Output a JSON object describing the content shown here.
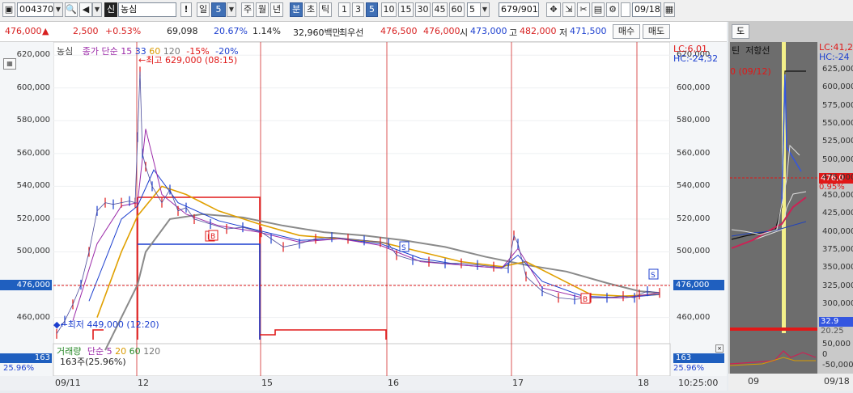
{
  "toolbar": {
    "code": "004370",
    "tag": "신",
    "name": "농심",
    "alert": "!",
    "period_label": "일",
    "period_value": "5",
    "tabs": [
      "주",
      "월",
      "년",
      "분",
      "초",
      "틱"
    ],
    "minutes": [
      "1",
      "3",
      "5",
      "10",
      "15",
      "30",
      "45",
      "60"
    ],
    "count": "5",
    "pages": "679/901",
    "date": "09/18"
  },
  "quote": {
    "price": "476,000",
    "change": "2,500",
    "pct": "+0.53%",
    "volume": "69,098",
    "turnover": "20.67%",
    "ratio": "1.14%",
    "amount": "32,960백만",
    "best_label": "최우선",
    "best_ask": "476,500",
    "best_bid": "476,000",
    "open_label": "시",
    "open": "473,000",
    "high_label": "고",
    "high": "482,000",
    "low_label": "저",
    "low": "471,500",
    "buy": "매수",
    "sell": "매도"
  },
  "legend": {
    "name": "농심",
    "ma_label": "종가 단순",
    "ma_periods": [
      "15",
      "33",
      "60",
      "120"
    ],
    "env1": "-15%",
    "env2": "-20%"
  },
  "annotations": {
    "high": "최고 629,000 (08:15)",
    "low": "최저 449,000 (12:20)",
    "lc": "LC:6,01",
    "hc": "HC:-24,32",
    "current_tag": "476,000"
  },
  "volume_legend": {
    "label": "거래량",
    "ma_label": "단순",
    "periods": [
      "5",
      "20",
      "60",
      "120"
    ],
    "value": "163주(25.96%)",
    "tag_value": "163",
    "tag_pct": "25.96%"
  },
  "x_labels": [
    "09/11",
    "12",
    "15",
    "16",
    "17",
    "18"
  ],
  "time_label": "10:25:00",
  "right_panel": {
    "header": "도",
    "tab1": "틴",
    "tab2": "저항선",
    "high_fragment": "0 (09/12)",
    "lc": "LC:41,2",
    "hc": "HC:-24",
    "price_tag": "476,0",
    "pct_tag": "0.95%",
    "vol_tag1": "32.9",
    "vol_tag2": "20.25",
    "y_ticks": [
      "625,000",
      "600,000",
      "575,000",
      "550,000",
      "525,000",
      "500,000",
      "475,000",
      "450,000",
      "425,000",
      "400,000",
      "375,000",
      "350,000",
      "325,000",
      "300,000"
    ],
    "vol_ticks": [
      "50,000",
      "0",
      "-50,000"
    ],
    "x_labels": [
      "09",
      "09/18"
    ]
  },
  "chart_data": {
    "type": "line",
    "y_ticks": [
      620000,
      600000,
      580000,
      560000,
      540000,
      520000,
      500000,
      480000,
      460000
    ],
    "ylim": [
      444000,
      628000
    ],
    "price_series": [
      [
        0,
        450000
      ],
      [
        10,
        458000
      ],
      [
        20,
        468000
      ],
      [
        30,
        480000
      ],
      [
        40,
        500000
      ],
      [
        50,
        525000
      ],
      [
        60,
        530000
      ],
      [
        70,
        529000
      ],
      [
        80,
        530000
      ],
      [
        90,
        531000
      ],
      [
        97,
        530000
      ],
      [
        100,
        570000
      ],
      [
        103,
        610000
      ],
      [
        106,
        560000
      ],
      [
        110,
        552000
      ],
      [
        118,
        540000
      ],
      [
        130,
        530000
      ],
      [
        140,
        538000
      ],
      [
        150,
        525000
      ],
      [
        160,
        527000
      ],
      [
        170,
        520000
      ],
      [
        190,
        517000
      ],
      [
        210,
        514000
      ],
      [
        230,
        515000
      ],
      [
        253,
        512000
      ],
      [
        265,
        508000
      ],
      [
        280,
        503000
      ],
      [
        300,
        505000
      ],
      [
        320,
        508000
      ],
      [
        340,
        509000
      ],
      [
        360,
        508000
      ],
      [
        380,
        507000
      ],
      [
        400,
        506000
      ],
      [
        410,
        505000
      ],
      [
        420,
        498000
      ],
      [
        440,
        495000
      ],
      [
        460,
        494000
      ],
      [
        480,
        493000
      ],
      [
        500,
        493000
      ],
      [
        520,
        492000
      ],
      [
        540,
        491000
      ],
      [
        558,
        490000
      ],
      [
        565,
        510000
      ],
      [
        570,
        505000
      ],
      [
        580,
        485000
      ],
      [
        600,
        476000
      ],
      [
        620,
        472000
      ],
      [
        640,
        471000
      ],
      [
        660,
        472000
      ],
      [
        680,
        472000
      ],
      [
        700,
        473000
      ],
      [
        714,
        472000
      ],
      [
        720,
        474000
      ],
      [
        730,
        476000
      ],
      [
        745,
        475000
      ]
    ],
    "series": [
      {
        "values_at": "ma15",
        "points": [
          [
            20,
            458000
          ],
          [
            50,
            505000
          ],
          [
            80,
            528000
          ],
          [
            100,
            530000
          ],
          [
            110,
            575000
          ],
          [
            130,
            535000
          ],
          [
            160,
            523000
          ],
          [
            200,
            516000
          ],
          [
            250,
            512000
          ],
          [
            300,
            506000
          ],
          [
            350,
            508000
          ],
          [
            400,
            504000
          ],
          [
            450,
            494000
          ],
          [
            500,
            492000
          ],
          [
            550,
            490000
          ],
          [
            570,
            502000
          ],
          [
            600,
            478000
          ],
          [
            650,
            472000
          ],
          [
            700,
            472000
          ],
          [
            745,
            475000
          ]
        ]
      },
      {
        "values_at": "ma33",
        "points": [
          [
            40,
            470000
          ],
          [
            80,
            520000
          ],
          [
            100,
            528000
          ],
          [
            120,
            550000
          ],
          [
            150,
            530000
          ],
          [
            200,
            519000
          ],
          [
            250,
            513000
          ],
          [
            300,
            507000
          ],
          [
            350,
            508000
          ],
          [
            400,
            505000
          ],
          [
            450,
            496000
          ],
          [
            500,
            492000
          ],
          [
            550,
            490000
          ],
          [
            570,
            498000
          ],
          [
            600,
            482000
          ],
          [
            650,
            473000
          ],
          [
            700,
            472000
          ],
          [
            745,
            474000
          ]
        ]
      },
      {
        "values_at": "ma60",
        "points": [
          [
            50,
            460000
          ],
          [
            80,
            500000
          ],
          [
            100,
            522000
          ],
          [
            130,
            540000
          ],
          [
            160,
            535000
          ],
          [
            200,
            525000
          ],
          [
            250,
            517000
          ],
          [
            300,
            510000
          ],
          [
            350,
            508000
          ],
          [
            400,
            506000
          ],
          [
            450,
            500000
          ],
          [
            500,
            494000
          ],
          [
            550,
            491000
          ],
          [
            580,
            494000
          ],
          [
            620,
            484000
          ],
          [
            660,
            474000
          ],
          [
            700,
            473000
          ],
          [
            745,
            474000
          ]
        ]
      },
      {
        "values_at": "ma120",
        "points": [
          [
            60,
            440000
          ],
          [
            100,
            480000
          ],
          [
            110,
            500000
          ],
          [
            140,
            520000
          ],
          [
            180,
            523000
          ],
          [
            230,
            521000
          ],
          [
            280,
            516000
          ],
          [
            330,
            512000
          ],
          [
            380,
            510000
          ],
          [
            430,
            507000
          ],
          [
            480,
            503000
          ],
          [
            530,
            497000
          ],
          [
            580,
            492000
          ],
          [
            630,
            488000
          ],
          [
            680,
            481000
          ],
          [
            720,
            476000
          ],
          [
            745,
            475000
          ]
        ]
      }
    ]
  }
}
